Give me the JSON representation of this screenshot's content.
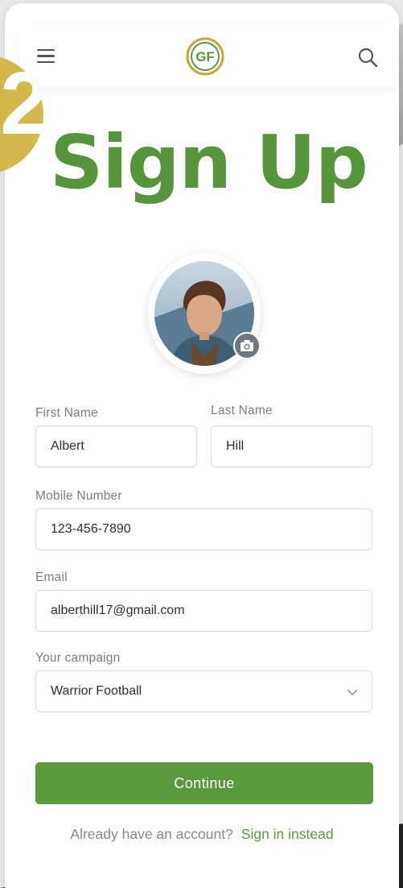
{
  "header": {
    "menu_icon": "hamburger-menu-icon",
    "logo_text": "GF",
    "search_icon": "search-icon"
  },
  "badge": {
    "text": "2",
    "color": "#d3b94b"
  },
  "page": {
    "title": "Sign Up"
  },
  "avatar": {
    "camera_icon": "camera-icon"
  },
  "form": {
    "first_name": {
      "label": "First Name",
      "value": "Albert"
    },
    "last_name": {
      "label": "Last Name",
      "value": "Hill"
    },
    "mobile": {
      "label": "Mobile Number",
      "value": "123-456-7890"
    },
    "email": {
      "label": "Email",
      "value": "alberthill17@gmail.com"
    },
    "campaign": {
      "label": "Your campaign",
      "value": "Warrior Football"
    }
  },
  "actions": {
    "continue_label": "Continue",
    "already_text": "Already have an account?",
    "sign_in_label": "Sign in instead"
  },
  "colors": {
    "accent": "#599a3f",
    "title": "#57953d",
    "gold": "#d3b94b"
  }
}
